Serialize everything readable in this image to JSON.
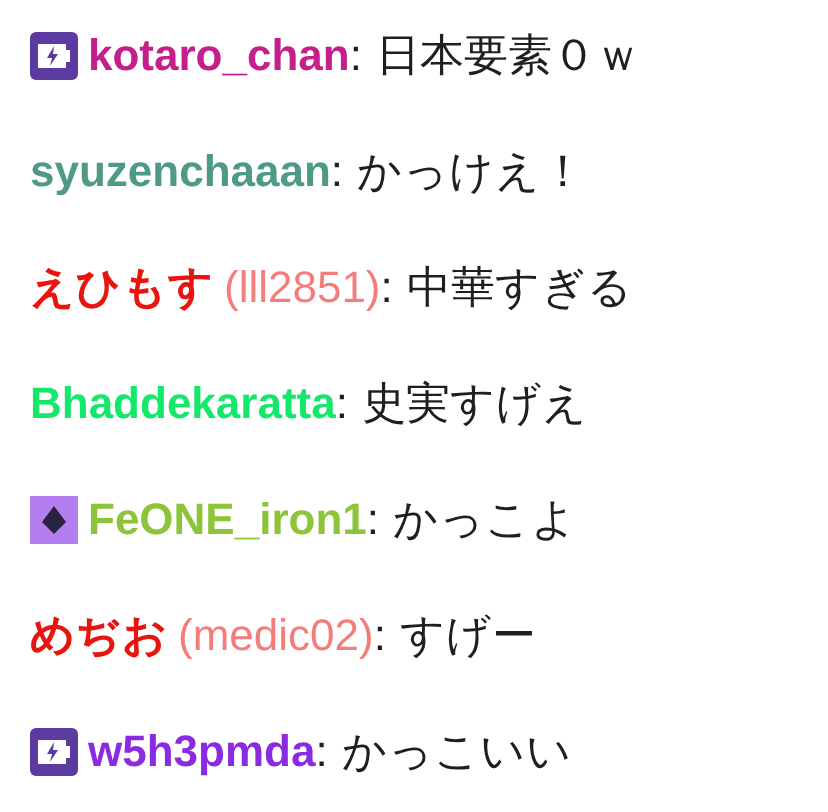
{
  "chat": [
    {
      "kind": "prime",
      "name": "kotaro_chan",
      "color": "#c41f8a",
      "separator": ":",
      "text": "日本要素０ｗ"
    },
    {
      "kind": "plain",
      "name": "syuzenchaaan",
      "color": "#4f9a86",
      "separator": ":",
      "text": "かっけえ！"
    },
    {
      "kind": "plain",
      "name": "えひもす",
      "login": "(lll2851)",
      "color": "#e8140f",
      "separator": ":",
      "text": "中華すぎる"
    },
    {
      "kind": "plain",
      "name": "Bhaddekaratta",
      "color": "#14e86a",
      "separator": ":",
      "text": "史実すげえ"
    },
    {
      "kind": "gem",
      "name": "FeONE_iron1",
      "color": "#8dc43a",
      "separator": ":",
      "text": "かっこよ"
    },
    {
      "kind": "plain",
      "name": "めぢお",
      "login": "(medic02)",
      "color": "#e8140f",
      "separator": ":",
      "text": "すげー"
    },
    {
      "kind": "prime",
      "name": "w5h3pmda",
      "color": "#8a2be2",
      "separator": ":",
      "text": "かっこいい"
    }
  ]
}
